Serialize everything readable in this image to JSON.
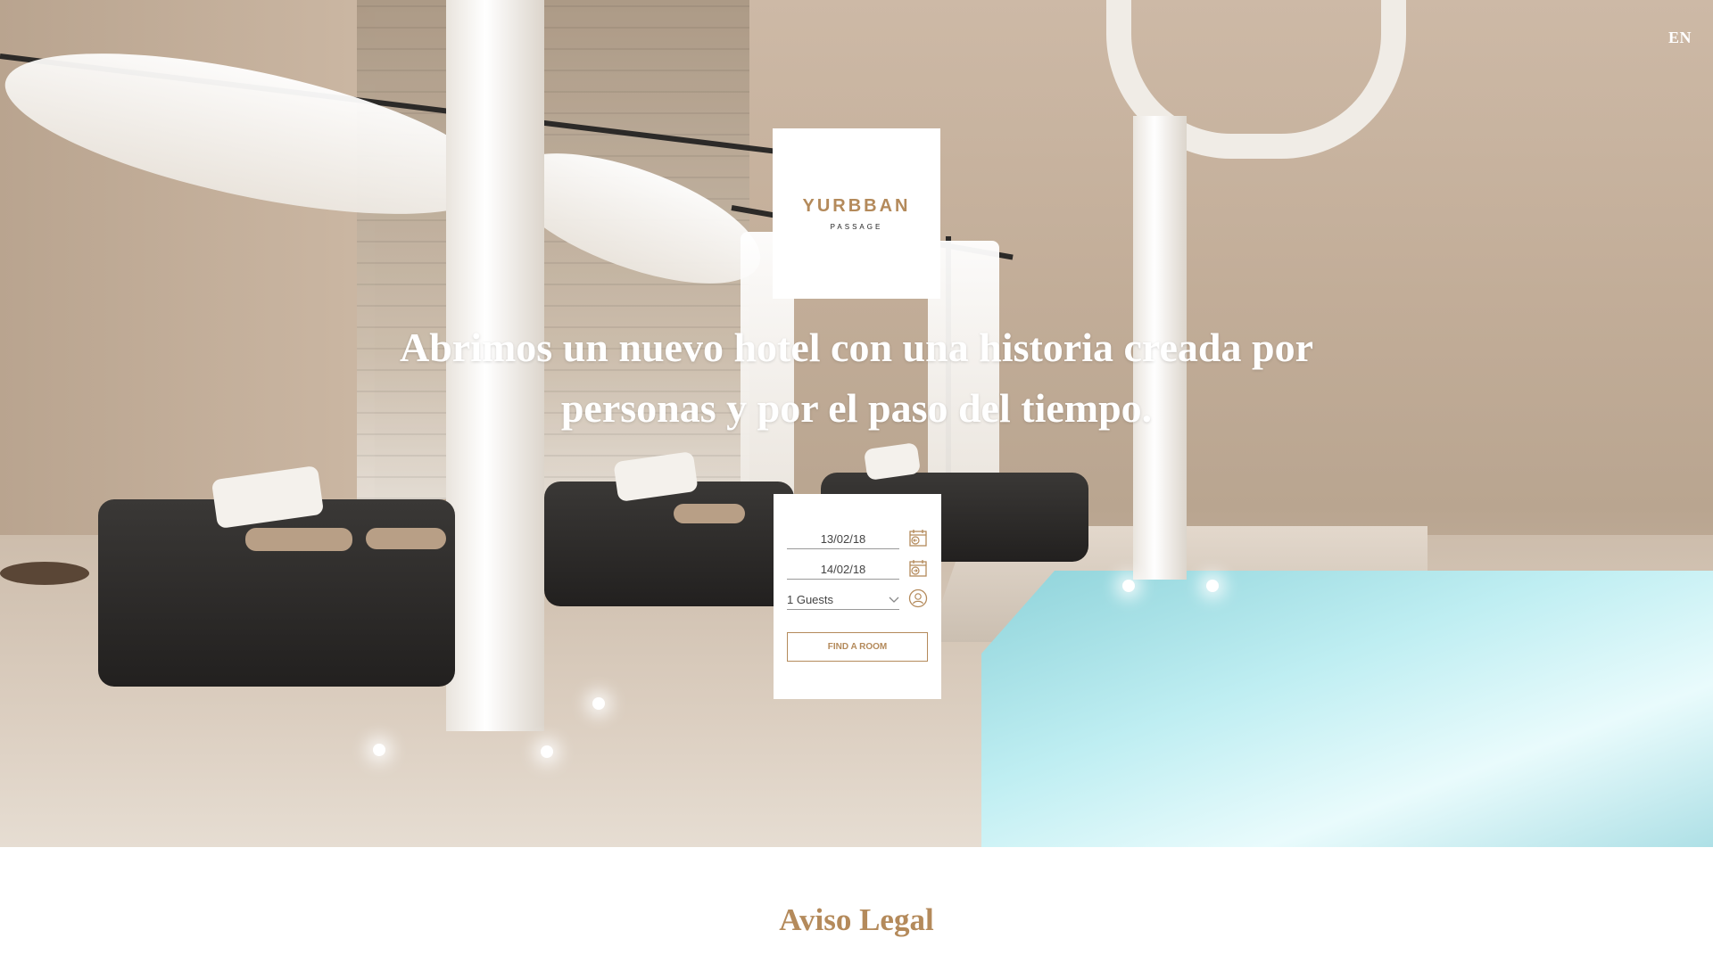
{
  "language_switch": {
    "label": "EN"
  },
  "logo": {
    "name": "YURBBAN",
    "subtitle": "PASSAGE"
  },
  "hero": {
    "headline_line1": "Abrimos un nuevo hotel con una historia creada por",
    "headline_line2": "personas y por el paso del tiempo.",
    "background_image": "hotel-spa-pool"
  },
  "booking": {
    "check_in": "13/02/18",
    "check_out": "14/02/18",
    "guests": "1 Guests",
    "check_in_icon": "calendar-arrow-in-icon",
    "check_out_icon": "calendar-arrow-out-icon",
    "guests_icon": "user-icon",
    "submit_label": "FIND A ROOM"
  },
  "footer_section": {
    "title": "Aviso Legal"
  },
  "colors": {
    "accent": "#b48a5b",
    "background": "#ffffff",
    "headline": "#ffffff"
  }
}
